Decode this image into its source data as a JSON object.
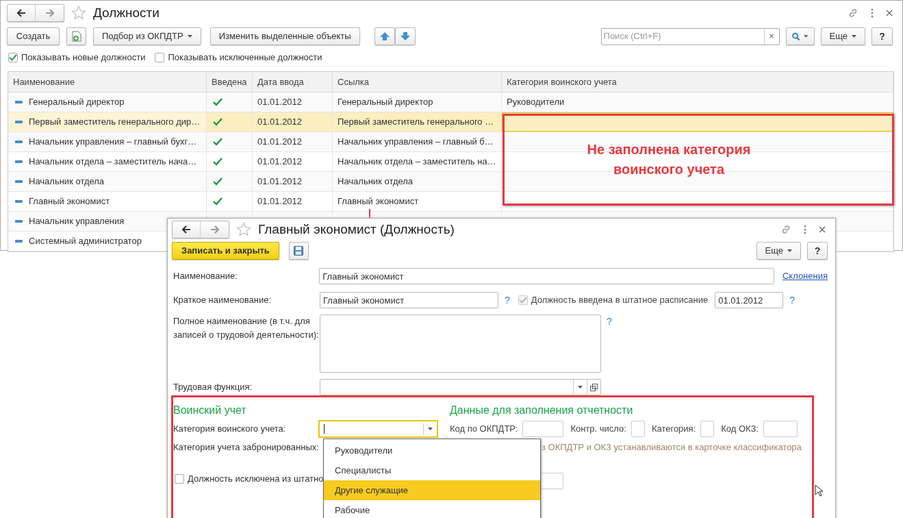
{
  "main_window": {
    "title": "Должности",
    "toolbar": {
      "create": "Создать",
      "pick": "Подбор из ОКПДТР",
      "edit_selected": "Изменить выделенные объекты",
      "search_placeholder": "Поиск (Ctrl+F)",
      "search_clear": "×",
      "more": "Еще",
      "help": "?"
    },
    "filters": [
      {
        "label": "Показывать новые должности",
        "checked": true
      },
      {
        "label": "Показывать исключенные должности",
        "checked": false
      }
    ],
    "table": {
      "columns": [
        "Наименование",
        "Введена",
        "Дата ввода",
        "Ссылка",
        "Категория воинского учета"
      ],
      "rows": [
        {
          "name": "Генеральный директор",
          "entered": true,
          "date": "01.01.2012",
          "link": "Генеральный директор",
          "category": "Руководители",
          "selected": false
        },
        {
          "name": "Первый заместитель генерального дир…",
          "entered": true,
          "date": "01.01.2012",
          "link": "Первый заместитель генерального …",
          "category": "",
          "selected": true
        },
        {
          "name": "Начальник управления – главный бухг…",
          "entered": true,
          "date": "01.01.2012",
          "link": "Начальник управления – главный б…",
          "category": "",
          "selected": false
        },
        {
          "name": "Начальник отдела – заместитель нача…",
          "entered": true,
          "date": "01.01.2012",
          "link": "Начальник отдела – заместитель на…",
          "category": "",
          "selected": false
        },
        {
          "name": "Начальник отдела",
          "entered": true,
          "date": "01.01.2012",
          "link": "Начальник отдела",
          "category": "",
          "selected": false
        },
        {
          "name": "Главный экономист",
          "entered": true,
          "date": "01.01.2012",
          "link": "Главный экономист",
          "category": "",
          "selected": false
        },
        {
          "name": "Начальник управления",
          "selected": false
        },
        {
          "name": "Системный администратор",
          "selected": false
        }
      ]
    }
  },
  "annotation": {
    "text": "Не заполнена категория воинского учета"
  },
  "dialog": {
    "title": "Главный экономист (Должность)",
    "save_close": "Записать и закрыть",
    "more": "Еще",
    "help": "?",
    "name": {
      "label": "Наименование:",
      "value": "Главный экономист",
      "link": "Склонения"
    },
    "short_name": {
      "label": "Краткое наименование:",
      "value": "Главный экономист",
      "hint": "?"
    },
    "in_schedule": {
      "label": "Должность введена в штатное расписание",
      "checked": true,
      "disabled": true,
      "date": "01.01.2012",
      "hint": "?"
    },
    "full_name": {
      "label": "Полное наименование (в т.ч. для записей о трудовой деятельности):",
      "hint": "?"
    },
    "labor_function": {
      "label": "Трудовая функция:"
    },
    "military": {
      "heading": "Воинский учет",
      "category_label": "Категория воинского учета:",
      "reserved_label": "Категория учета забронированных:",
      "options": [
        {
          "label": "Руководители",
          "selected": false
        },
        {
          "label": "Специалисты",
          "selected": false
        },
        {
          "label": "Другие служащие",
          "selected": true
        },
        {
          "label": "Рабочие",
          "selected": false
        }
      ]
    },
    "reporting": {
      "heading": "Данные для заполнения отчетности",
      "codes": [
        {
          "label": "Код по ОКПДТР:"
        },
        {
          "label": "Контр. число:"
        },
        {
          "label": "Категория:"
        },
        {
          "label": "Код ОКЗ:"
        }
      ],
      "note": "з ОКПДТР и ОКЗ устанавливаются в карточке классификатора"
    },
    "excluded": {
      "label": "Должность исключена из штатно",
      "checked": false
    }
  }
}
